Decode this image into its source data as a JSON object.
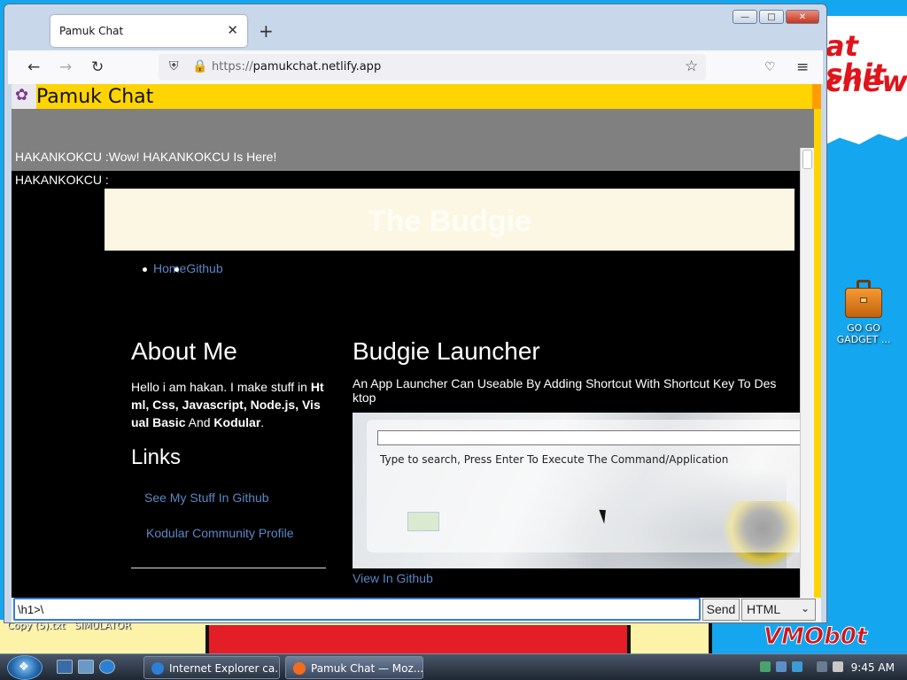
{
  "browser": {
    "tab_title": "Pamuk Chat",
    "url_scheme": "https://",
    "url_host": "pamukchat.netlify.app"
  },
  "app": {
    "title": "Pamuk Chat",
    "messages": [
      "HAKANKOKCU :Wow! HAKANKOKCU Is Here!",
      "HAKANKOKCU :"
    ]
  },
  "embedded_page": {
    "banner_title": "The Budgie",
    "nav_links": [
      "Home",
      "Github"
    ],
    "about_title": "About Me",
    "about_text_prefix": "Hello i am hakan. I make stuff in ",
    "about_bold_1": "Html, Css, Javascript, Node.js, Visual Basic",
    "about_text_mid": " And ",
    "about_bold_2": "Kodular",
    "about_text_end": ".",
    "links_title": "Links",
    "link_1": "See My Stuff In Github",
    "link_2": "Kodular Community Profile",
    "launcher_title": "Budgie Launcher",
    "launcher_desc": "An App Launcher Can Useable By Adding Shortcut With Shortcut Key To Desktop",
    "launcher_hint": "Type to search, Press Enter To Execute The Command/Application",
    "view_github": "View In Github"
  },
  "composer": {
    "input_value": "\\h1>\\",
    "send_label": "Send",
    "type_value": "HTML"
  },
  "desktop": {
    "icon_label": "GO GO GADGET ...",
    "wall_text_1": "at shit",
    "wall_text_2": "chew",
    "file_1": "Copy (5).txt",
    "file_2": "SIMULATOR",
    "watermark": "VMOb0t"
  },
  "taskbar": {
    "items": [
      "Internet Explorer ca...",
      "Pamuk Chat — Moz..."
    ],
    "clock": "9:45 AM"
  },
  "colors": {
    "header_yellow": "#ffd400",
    "link_blue": "#5c87c3",
    "banner_cream": "#fcf7e3"
  }
}
